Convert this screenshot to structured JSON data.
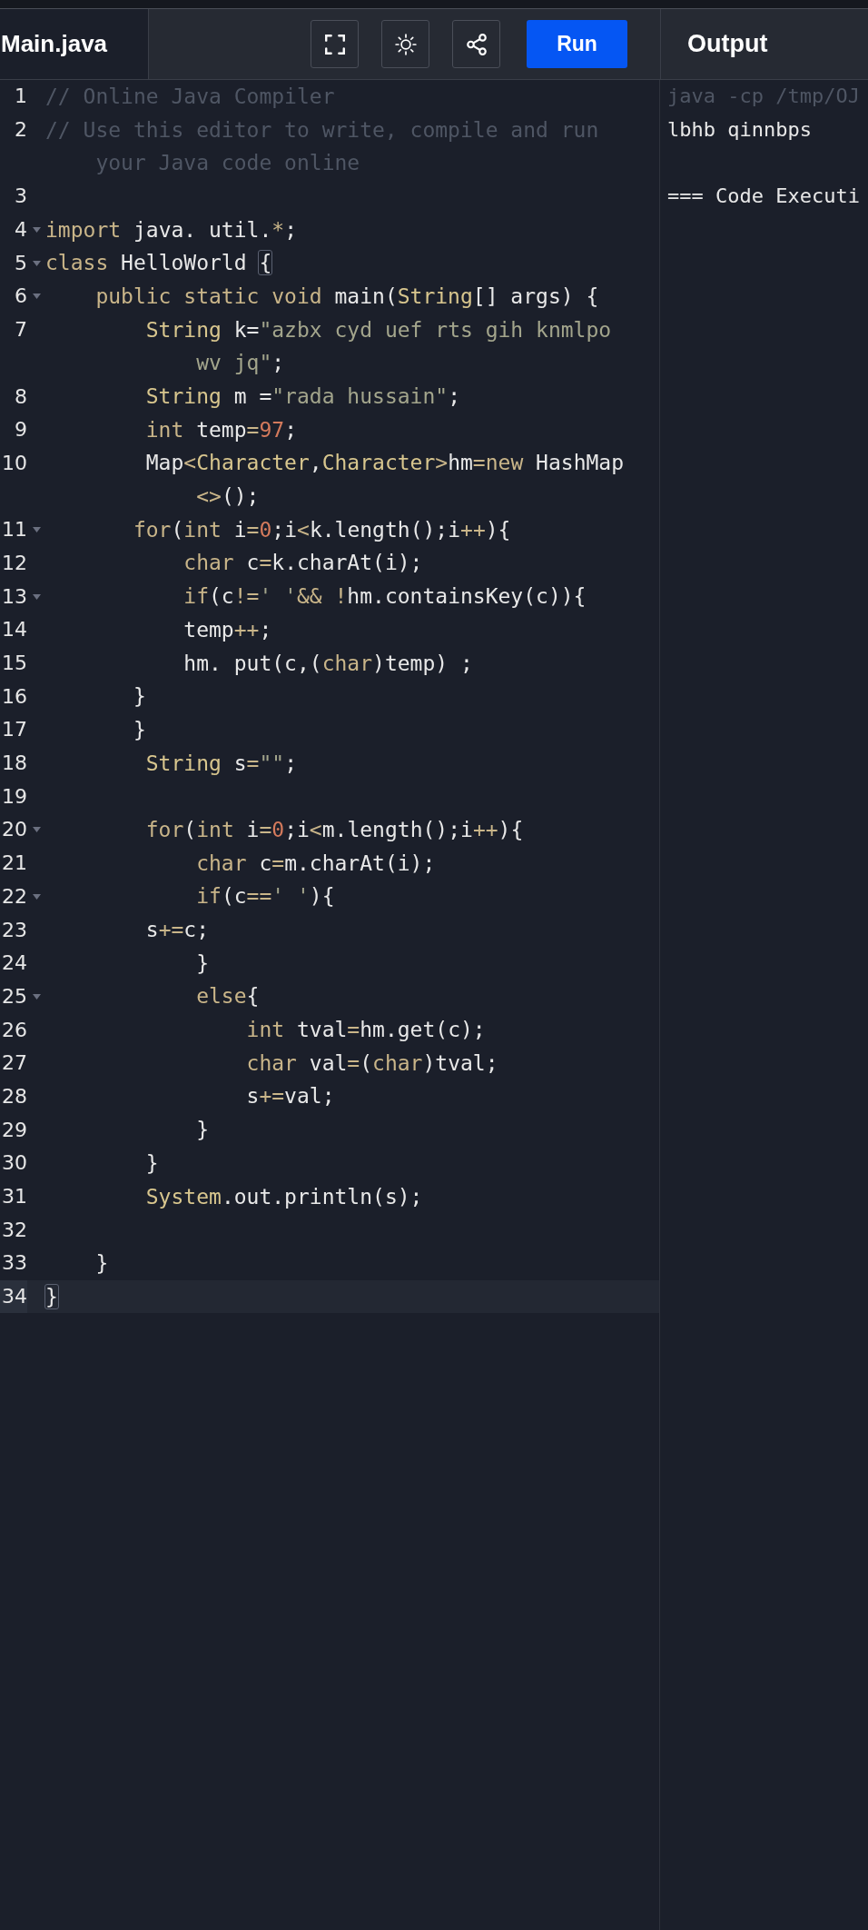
{
  "editor_tab": {
    "label": "Main.java",
    "selected": true
  },
  "toolbar": {
    "buttons": [
      {
        "kind": "fullscreen"
      },
      {
        "kind": "theme"
      },
      {
        "kind": "share"
      }
    ],
    "run_button": "Run"
  },
  "output_header": "Output",
  "code_lines": [
    {
      "number": "1",
      "foldable": false,
      "current": false,
      "tokens": [
        {
          "text": "// Online Java Compiler",
          "kind": "comment"
        }
      ]
    },
    {
      "number": "2",
      "foldable": false,
      "current": false,
      "tokens": [
        {
          "text": "// Use this editor to write, compile and run",
          "kind": "comment"
        }
      ],
      "wrapped_tokens": [
        {
          "text": "    your Java code online",
          "kind": "comment"
        }
      ]
    },
    {
      "number": "3",
      "foldable": false,
      "current": false
    },
    {
      "number": "4",
      "foldable": true,
      "current": false,
      "tokens": [
        {
          "text": "import",
          "kind": "keyword"
        },
        {
          "text": " java. util.",
          "kind": "plain"
        },
        {
          "text": "*",
          "kind": "op"
        },
        {
          "text": ";",
          "kind": "plain"
        }
      ]
    },
    {
      "number": "5",
      "foldable": true,
      "current": false,
      "tokens": [
        {
          "text": "class",
          "kind": "keyword"
        },
        {
          "text": " HelloWorld ",
          "kind": "plain"
        },
        {
          "text": "{",
          "kind": "bracket"
        }
      ]
    },
    {
      "number": "6",
      "foldable": true,
      "current": false,
      "tokens": [
        {
          "text": "    public static void",
          "kind": "keyword"
        },
        {
          "text": " main(",
          "kind": "plain"
        },
        {
          "text": "String",
          "kind": "type"
        },
        {
          "text": "[] args) {",
          "kind": "plain"
        }
      ]
    },
    {
      "number": "7",
      "foldable": false,
      "current": false,
      "tokens": [
        {
          "text": "        String",
          "kind": "type"
        },
        {
          "text": " k=",
          "kind": "plain"
        },
        {
          "text": "\"azbx cyd uef rts gih knmlpo",
          "kind": "string"
        }
      ],
      "wrapped_tokens": [
        {
          "text": "            wv jq\"",
          "kind": "string"
        },
        {
          "text": ";",
          "kind": "plain"
        }
      ]
    },
    {
      "number": "8",
      "foldable": false,
      "current": false,
      "tokens": [
        {
          "text": "        String",
          "kind": "type"
        },
        {
          "text": " m =",
          "kind": "plain"
        },
        {
          "text": "\"rada hussain\"",
          "kind": "string"
        },
        {
          "text": ";",
          "kind": "plain"
        }
      ]
    },
    {
      "number": "9",
      "foldable": false,
      "current": false,
      "tokens": [
        {
          "text": "        int",
          "kind": "keyword"
        },
        {
          "text": " temp",
          "kind": "plain"
        },
        {
          "text": "=",
          "kind": "op"
        },
        {
          "text": "97",
          "kind": "number"
        },
        {
          "text": ";",
          "kind": "plain"
        }
      ]
    },
    {
      "number": "10",
      "foldable": false,
      "current": false,
      "tokens": [
        {
          "text": "        Map",
          "kind": "plain"
        },
        {
          "text": "<",
          "kind": "op"
        },
        {
          "text": "Character",
          "kind": "type"
        },
        {
          "text": ",",
          "kind": "plain"
        },
        {
          "text": "Character",
          "kind": "type"
        },
        {
          "text": ">",
          "kind": "op"
        },
        {
          "text": "hm",
          "kind": "plain"
        },
        {
          "text": "=new",
          "kind": "op"
        },
        {
          "text": " HashMap",
          "kind": "plain"
        }
      ],
      "wrapped_tokens": [
        {
          "text": "            <>",
          "kind": "op"
        },
        {
          "text": "();",
          "kind": "plain"
        }
      ]
    },
    {
      "number": "11",
      "foldable": true,
      "current": false,
      "tokens": [
        {
          "text": "       for",
          "kind": "keyword"
        },
        {
          "text": "(",
          "kind": "plain"
        },
        {
          "text": "int",
          "kind": "keyword"
        },
        {
          "text": " i",
          "kind": "plain"
        },
        {
          "text": "=",
          "kind": "op"
        },
        {
          "text": "0",
          "kind": "number"
        },
        {
          "text": ";i",
          "kind": "plain"
        },
        {
          "text": "<",
          "kind": "op"
        },
        {
          "text": "k.length();i",
          "kind": "plain"
        },
        {
          "text": "++",
          "kind": "op"
        },
        {
          "text": "){",
          "kind": "plain"
        }
      ]
    },
    {
      "number": "12",
      "foldable": false,
      "current": false,
      "tokens": [
        {
          "text": "           char",
          "kind": "keyword"
        },
        {
          "text": " c",
          "kind": "plain"
        },
        {
          "text": "=",
          "kind": "op"
        },
        {
          "text": "k.charAt(i);",
          "kind": "plain"
        }
      ]
    },
    {
      "number": "13",
      "foldable": true,
      "current": false,
      "tokens": [
        {
          "text": "           if",
          "kind": "keyword"
        },
        {
          "text": "(c",
          "kind": "plain"
        },
        {
          "text": "!=",
          "kind": "op"
        },
        {
          "text": "' '",
          "kind": "string"
        },
        {
          "text": "&& !",
          "kind": "op"
        },
        {
          "text": "hm.containsKey(c)){",
          "kind": "plain"
        }
      ]
    },
    {
      "number": "14",
      "foldable": false,
      "current": false,
      "tokens": [
        {
          "text": "           temp",
          "kind": "plain"
        },
        {
          "text": "++",
          "kind": "op"
        },
        {
          "text": ";",
          "kind": "plain"
        }
      ]
    },
    {
      "number": "15",
      "foldable": false,
      "current": false,
      "tokens": [
        {
          "text": "           hm. put(c,(",
          "kind": "plain"
        },
        {
          "text": "char",
          "kind": "keyword"
        },
        {
          "text": ")temp) ;",
          "kind": "plain"
        }
      ]
    },
    {
      "number": "16",
      "foldable": false,
      "current": false,
      "tokens": [
        {
          "text": "       }",
          "kind": "plain"
        }
      ]
    },
    {
      "number": "17",
      "foldable": false,
      "current": false,
      "tokens": [
        {
          "text": "       }",
          "kind": "plain"
        }
      ]
    },
    {
      "number": "18",
      "foldable": false,
      "current": false,
      "tokens": [
        {
          "text": "        String",
          "kind": "type"
        },
        {
          "text": " s",
          "kind": "plain"
        },
        {
          "text": "=",
          "kind": "op"
        },
        {
          "text": "\"\"",
          "kind": "string"
        },
        {
          "text": ";",
          "kind": "plain"
        }
      ]
    },
    {
      "number": "19",
      "foldable": false,
      "current": false
    },
    {
      "number": "20",
      "foldable": true,
      "current": false,
      "tokens": [
        {
          "text": "        for",
          "kind": "keyword"
        },
        {
          "text": "(",
          "kind": "plain"
        },
        {
          "text": "int",
          "kind": "keyword"
        },
        {
          "text": " i",
          "kind": "plain"
        },
        {
          "text": "=",
          "kind": "op"
        },
        {
          "text": "0",
          "kind": "number"
        },
        {
          "text": ";i",
          "kind": "plain"
        },
        {
          "text": "<",
          "kind": "op"
        },
        {
          "text": "m.length();i",
          "kind": "plain"
        },
        {
          "text": "++",
          "kind": "op"
        },
        {
          "text": "){",
          "kind": "plain"
        }
      ]
    },
    {
      "number": "21",
      "foldable": false,
      "current": false,
      "tokens": [
        {
          "text": "            char",
          "kind": "keyword"
        },
        {
          "text": " c",
          "kind": "plain"
        },
        {
          "text": "=",
          "kind": "op"
        },
        {
          "text": "m.charAt(i);",
          "kind": "plain"
        }
      ]
    },
    {
      "number": "22",
      "foldable": true,
      "current": false,
      "tokens": [
        {
          "text": "            if",
          "kind": "keyword"
        },
        {
          "text": "(c",
          "kind": "plain"
        },
        {
          "text": "==",
          "kind": "op"
        },
        {
          "text": "' '",
          "kind": "string"
        },
        {
          "text": "){",
          "kind": "plain"
        }
      ]
    },
    {
      "number": "23",
      "foldable": false,
      "current": false,
      "tokens": [
        {
          "text": "        s",
          "kind": "plain"
        },
        {
          "text": "+=",
          "kind": "op"
        },
        {
          "text": "c;",
          "kind": "plain"
        }
      ]
    },
    {
      "number": "24",
      "foldable": false,
      "current": false,
      "tokens": [
        {
          "text": "            }",
          "kind": "plain"
        }
      ]
    },
    {
      "number": "25",
      "foldable": true,
      "current": false,
      "tokens": [
        {
          "text": "            else",
          "kind": "keyword"
        },
        {
          "text": "{",
          "kind": "plain"
        }
      ]
    },
    {
      "number": "26",
      "foldable": false,
      "current": false,
      "tokens": [
        {
          "text": "                int",
          "kind": "keyword"
        },
        {
          "text": " tval",
          "kind": "plain"
        },
        {
          "text": "=",
          "kind": "op"
        },
        {
          "text": "hm.get(c);",
          "kind": "plain"
        }
      ]
    },
    {
      "number": "27",
      "foldable": false,
      "current": false,
      "tokens": [
        {
          "text": "                char",
          "kind": "keyword"
        },
        {
          "text": " val",
          "kind": "plain"
        },
        {
          "text": "=",
          "kind": "op"
        },
        {
          "text": "(",
          "kind": "plain"
        },
        {
          "text": "char",
          "kind": "keyword"
        },
        {
          "text": ")tval;",
          "kind": "plain"
        }
      ]
    },
    {
      "number": "28",
      "foldable": false,
      "current": false,
      "tokens": [
        {
          "text": "                s",
          "kind": "plain"
        },
        {
          "text": "+=",
          "kind": "op"
        },
        {
          "text": "val;",
          "kind": "plain"
        }
      ]
    },
    {
      "number": "29",
      "foldable": false,
      "current": false,
      "tokens": [
        {
          "text": "            }",
          "kind": "plain"
        }
      ]
    },
    {
      "number": "30",
      "foldable": false,
      "current": false,
      "tokens": [
        {
          "text": "        }",
          "kind": "plain"
        }
      ]
    },
    {
      "number": "31",
      "foldable": false,
      "current": false,
      "tokens": [
        {
          "text": "        System",
          "kind": "type"
        },
        {
          "text": ".out.println(s);",
          "kind": "plain"
        }
      ]
    },
    {
      "number": "32",
      "foldable": false,
      "current": false
    },
    {
      "number": "33",
      "foldable": false,
      "current": false,
      "tokens": [
        {
          "text": "    }",
          "kind": "plain"
        }
      ]
    },
    {
      "number": "34",
      "foldable": false,
      "current": true,
      "tokens": [
        {
          "text": "}",
          "kind": "bracket"
        }
      ]
    }
  ],
  "output_lines": [
    {
      "text": "java -cp /tmp/OJ",
      "kind": "command"
    },
    {
      "text": "lbhb qinnbps",
      "kind": "stdout"
    },
    {
      "text": "=== Code Executi",
      "kind": "status"
    }
  ]
}
